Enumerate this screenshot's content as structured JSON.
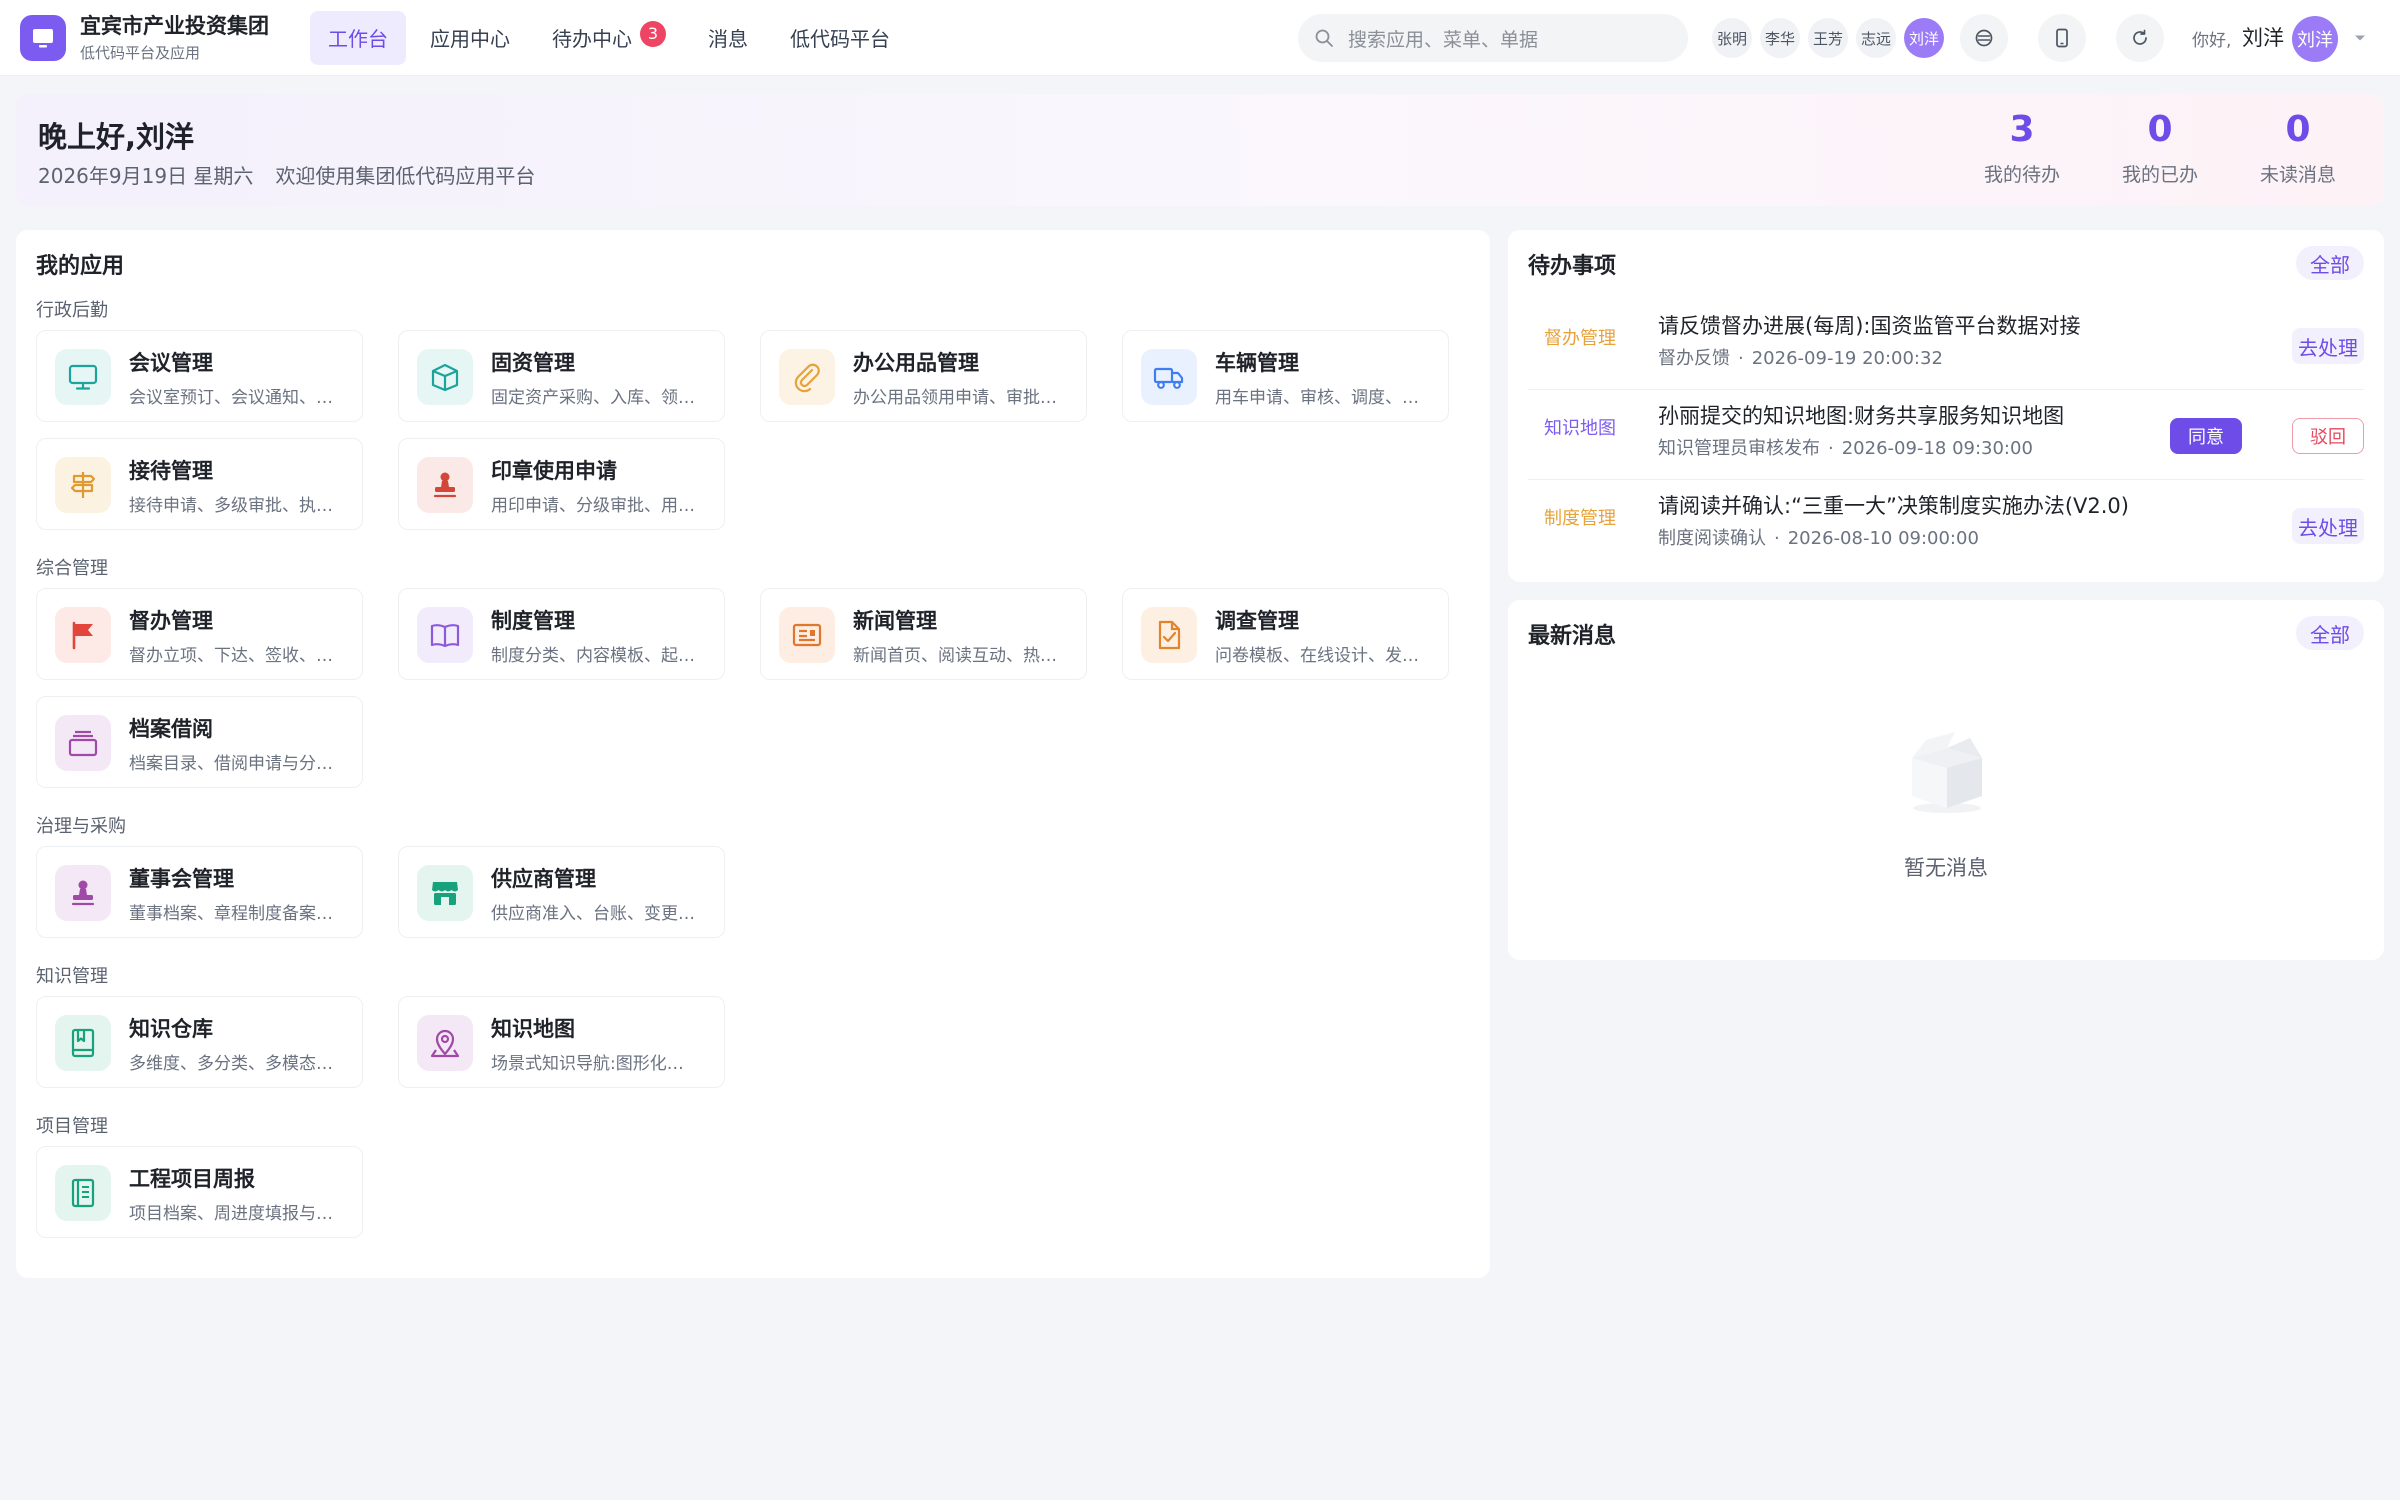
{
  "header": {
    "org_name": "宜宾市产业投资集团",
    "org_sub": "低代码平台及应用",
    "nav": [
      {
        "label": "工作台"
      },
      {
        "label": "应用中心"
      },
      {
        "label": "待办中心",
        "badge": "3"
      },
      {
        "label": "消息"
      },
      {
        "label": "低代码平台"
      }
    ],
    "search_placeholder": "搜索应用、菜单、单据",
    "user_chips": [
      "张明",
      "李华",
      "王芳",
      "志远",
      "刘洋"
    ],
    "greeting_prefix": "你好,",
    "user_name": "刘洋",
    "avatar_text": "刘洋"
  },
  "banner": {
    "greeting": "晚上好,刘洋",
    "date": "2026年9月19日 星期六",
    "welcome": "欢迎使用集团低代码应用平台",
    "stats": [
      {
        "value": "3",
        "label": "我的待办"
      },
      {
        "value": "0",
        "label": "我的已办"
      },
      {
        "value": "0",
        "label": "未读消息"
      }
    ]
  },
  "apps": {
    "title": "我的应用",
    "sections": [
      {
        "label": "行政后勤",
        "items": [
          {
            "name": "会议管理",
            "desc": "会议室预订、会议通知、…",
            "icon": "monitor-icon",
            "color": "#1ba39c",
            "bg": "#e6f6f4"
          },
          {
            "name": "固资管理",
            "desc": "固定资产采购、入库、领…",
            "icon": "box-icon",
            "color": "#1ba39c",
            "bg": "#e6f6f4"
          },
          {
            "name": "办公用品管理",
            "desc": "办公用品领用申请、审批…",
            "icon": "paperclip-icon",
            "color": "#e7a23a",
            "bg": "#fdf3e4"
          },
          {
            "name": "车辆管理",
            "desc": "用车申请、审核、调度、…",
            "icon": "truck-icon",
            "color": "#3f7ef0",
            "bg": "#e9f1fe"
          },
          {
            "name": "接待管理",
            "desc": "接待申请、多级审批、执…",
            "icon": "signpost-icon",
            "color": "#e09a30",
            "bg": "#fcf2e2"
          },
          {
            "name": "印章使用申请",
            "desc": "用印申请、分级审批、用…",
            "icon": "stamp-icon",
            "color": "#d2473a",
            "bg": "#fbe9e7"
          }
        ]
      },
      {
        "label": "综合管理",
        "items": [
          {
            "name": "督办管理",
            "desc": "督办立项、下达、签收、…",
            "icon": "flag-icon",
            "color": "#e2453b",
            "bg": "#fde9e6"
          },
          {
            "name": "制度管理",
            "desc": "制度分类、内容模板、起…",
            "icon": "book-open-icon",
            "color": "#8c5ad8",
            "bg": "#f1ebfb"
          },
          {
            "name": "新闻管理",
            "desc": "新闻首页、阅读互动、热…",
            "icon": "newspaper-icon",
            "color": "#e0772c",
            "bg": "#fdede2"
          },
          {
            "name": "调查管理",
            "desc": "问卷模板、在线设计、发…",
            "icon": "file-check-icon",
            "color": "#e0852c",
            "bg": "#fdefe2"
          },
          {
            "name": "档案借阅",
            "desc": "档案目录、借阅申请与分…",
            "icon": "archive-icon",
            "color": "#a04aa8",
            "bg": "#f5e8f6"
          }
        ]
      },
      {
        "label": "治理与采购",
        "items": [
          {
            "name": "董事会管理",
            "desc": "董事档案、章程制度备案…",
            "icon": "stamp-icon",
            "color": "#a04aa8",
            "bg": "#f5e8f6"
          },
          {
            "name": "供应商管理",
            "desc": "供应商准入、台账、变更…",
            "icon": "store-icon",
            "color": "#17a27d",
            "bg": "#e4f5ef"
          }
        ]
      },
      {
        "label": "知识管理",
        "items": [
          {
            "name": "知识仓库",
            "desc": "多维度、多分类、多模态…",
            "icon": "bookmark-book-icon",
            "color": "#17a27d",
            "bg": "#e4f5ef"
          },
          {
            "name": "知识地图",
            "desc": "场景式知识导航:图形化…",
            "icon": "map-pin-icon",
            "color": "#a04aa8",
            "bg": "#f5e8f6"
          }
        ]
      },
      {
        "label": "项目管理",
        "items": [
          {
            "name": "工程项目周报",
            "desc": "项目档案、周进度填报与…",
            "icon": "notebook-icon",
            "color": "#17a27d",
            "bg": "#e4f5ef"
          }
        ]
      }
    ]
  },
  "todos": {
    "title": "待办事项",
    "all_label": "全部",
    "items": [
      {
        "tag": "督办管理",
        "tag_color": "#e7a23a",
        "title": "请反馈督办进展(每周):国资监管平台数据对接",
        "source": "督办反馈",
        "time": "2026-09-19 20:00:32",
        "actions": [
          "去处理"
        ]
      },
      {
        "tag": "知识地图",
        "tag_color": "#7c5cf0",
        "title": "孙丽提交的知识地图:财务共享服务知识地图",
        "source": "知识管理员审核发布",
        "time": "2026-09-18 09:30:00",
        "actions": [
          "同意",
          "驳回"
        ]
      },
      {
        "tag": "制度管理",
        "tag_color": "#e7a23a",
        "title": "请阅读并确认:“三重一大”决策制度实施办法(V2.0)",
        "source": "制度阅读确认",
        "time": "2026-08-10 09:00:00",
        "actions": [
          "去处理"
        ]
      }
    ]
  },
  "news": {
    "title": "最新消息",
    "all_label": "全部",
    "empty_text": "暂无消息"
  },
  "colors": {
    "accent": "#6d4ce8",
    "danger": "#ef4565"
  }
}
